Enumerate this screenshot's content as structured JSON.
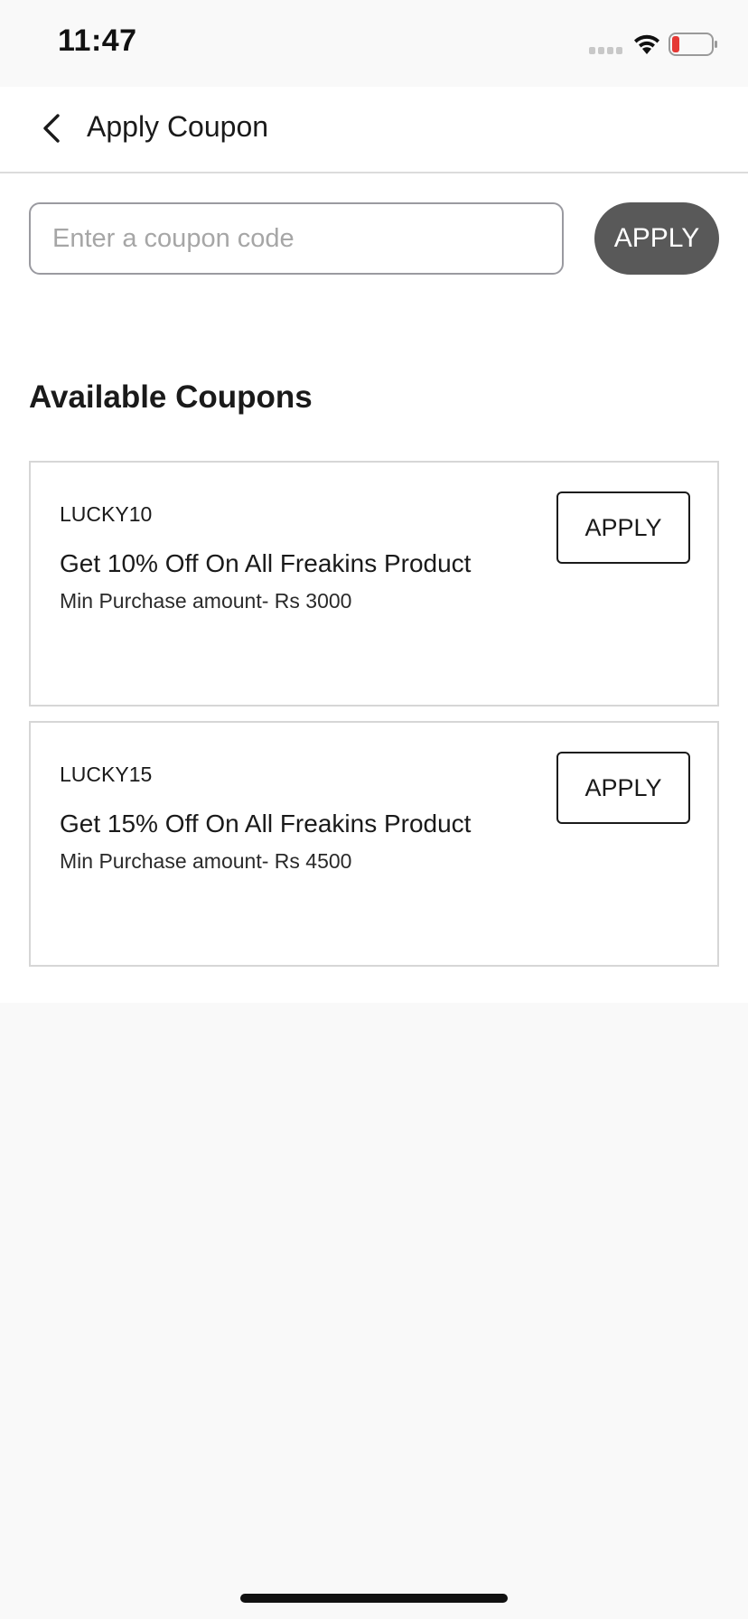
{
  "status_bar": {
    "time": "11:47",
    "battery_color": "#e53935",
    "icons": [
      "signal-dots-icon",
      "wifi-icon",
      "battery-icon"
    ]
  },
  "header": {
    "title": "Apply Coupon",
    "back_icon": "chevron-left-icon"
  },
  "coupon_entry": {
    "placeholder": "Enter a coupon code",
    "value": "",
    "apply_label": "APPLY"
  },
  "available": {
    "title": "Available Coupons",
    "coupons": [
      {
        "code": "LUCKY10",
        "description": "Get 10% Off On All Freakins Product",
        "min_purchase": "Min Purchase amount- Rs 3000",
        "apply_label": "APPLY"
      },
      {
        "code": "LUCKY15",
        "description": "Get 15% Off On All Freakins Product",
        "min_purchase": "Min Purchase amount- Rs 4500",
        "apply_label": "APPLY"
      }
    ]
  },
  "colors": {
    "apply_main_bg": "#595959",
    "page_bg": "#f9f9f9",
    "card_border": "#d6d6d6"
  }
}
